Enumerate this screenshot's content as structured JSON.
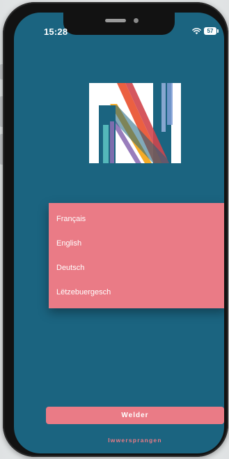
{
  "status_bar": {
    "time": "15:28",
    "battery": "57",
    "icons": [
      "wifi-icon",
      "battery-icon"
    ]
  },
  "logo": {
    "letter": "N",
    "colors": {
      "background": "#ffffff",
      "letter": "#1b6480",
      "stripes": [
        "#e94f2c",
        "#f3a61c",
        "#8e6fb5",
        "#5bc1c0",
        "#7f9ed6",
        "#d0454c"
      ]
    }
  },
  "language_menu": {
    "items": [
      {
        "label": "Français"
      },
      {
        "label": "English"
      },
      {
        "label": "Deutsch"
      },
      {
        "label": "Lëtzebuergesch"
      }
    ]
  },
  "actions": {
    "continue_label": "Welder",
    "skip_label": "Iwwersprangen"
  },
  "theme": {
    "screen_background": "#1b6480",
    "accent": "#ea7b86",
    "text_on_accent": "#ffffff"
  }
}
